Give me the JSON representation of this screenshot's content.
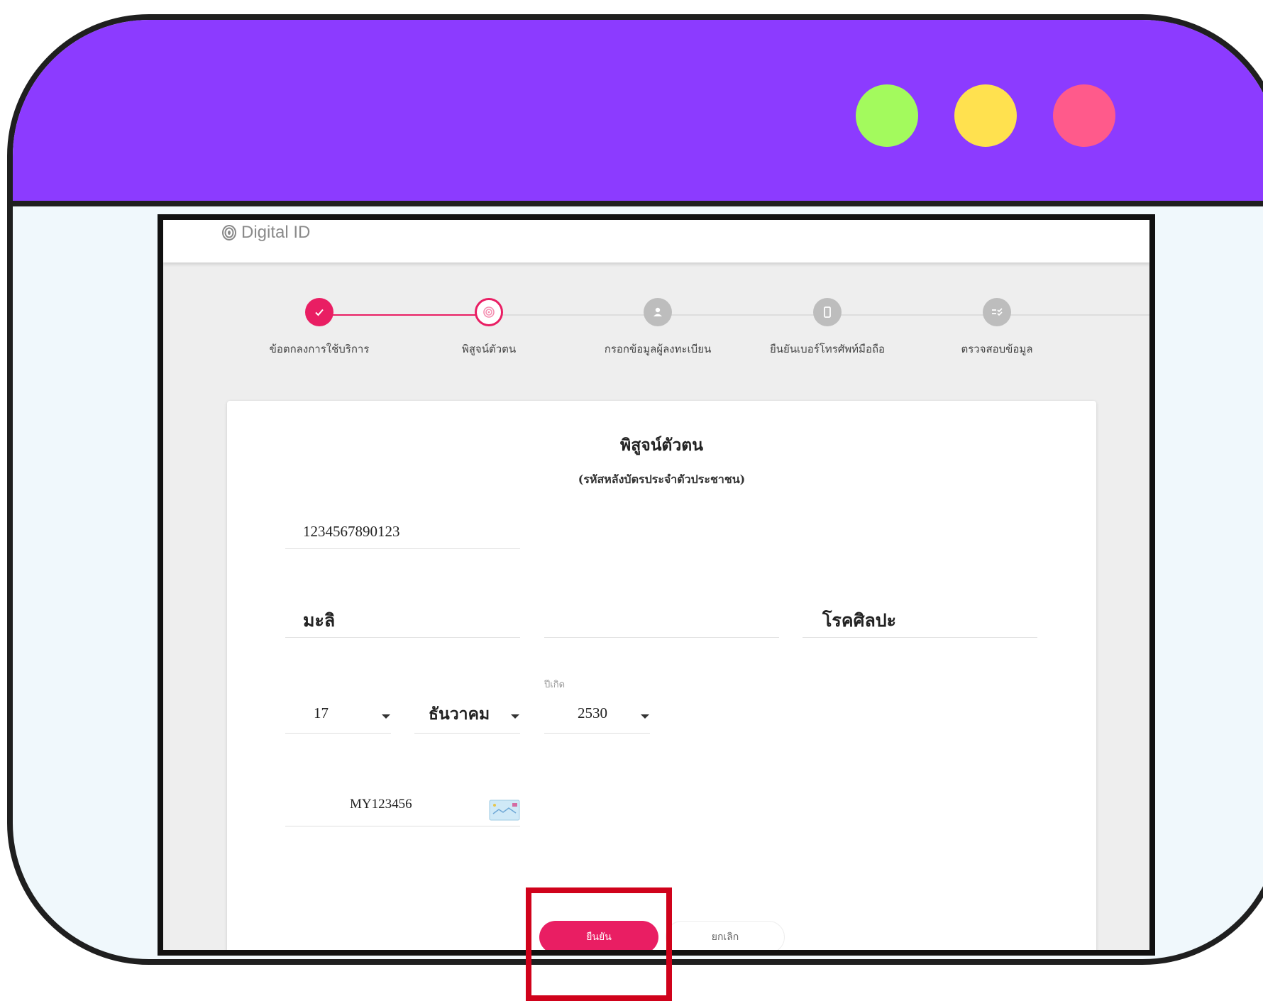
{
  "window": {
    "controls": [
      {
        "name": "green-dot",
        "color": "#a3fa5d"
      },
      {
        "name": "yellow-dot",
        "color": "#ffe14f"
      },
      {
        "name": "pink-dot",
        "color": "#ff5a8b"
      }
    ],
    "title_bar_color": "#8c3bff"
  },
  "app": {
    "logo_text": "Digital ID",
    "logo_icon": "fingerprint-icon"
  },
  "stepper": {
    "active_color": "#e91e63",
    "inactive_color": "#bdbdbd",
    "steps": [
      {
        "label": "ข้อตกลงการใช้บริการ",
        "status": "done",
        "icon": "check-icon"
      },
      {
        "label": "พิสูจน์ตัวตน",
        "status": "current",
        "icon": "fingerprint-icon"
      },
      {
        "label": "กรอกข้อมูลผู้ลงทะเบียน",
        "status": "pending",
        "icon": "person-icon"
      },
      {
        "label": "ยืนยันเบอร์โทรศัพท์มือถือ",
        "status": "pending",
        "icon": "phone-icon"
      },
      {
        "label": "ตรวจสอบข้อมูล",
        "status": "pending",
        "icon": "checklist-icon"
      }
    ]
  },
  "form": {
    "title": "พิสูจน์ตัวตน",
    "subtitle": "(รหัสหลังบัตรประจำตัวประชาชน)",
    "id_number": "1234567890123",
    "first_name": "มะลิ",
    "middle_name": "",
    "last_name": "โรคศิลปะ",
    "birth_day": "17",
    "birth_month": "ธันวาคม",
    "birth_year_label": "ปีเกิด",
    "birth_year": "2530",
    "laser_code": "MY123456",
    "card_icon": "id-card-icon",
    "confirm_label": "ยืนยัน",
    "cancel_label": "ยกเลิก"
  },
  "annotation": {
    "highlight_color": "#d0021b"
  }
}
